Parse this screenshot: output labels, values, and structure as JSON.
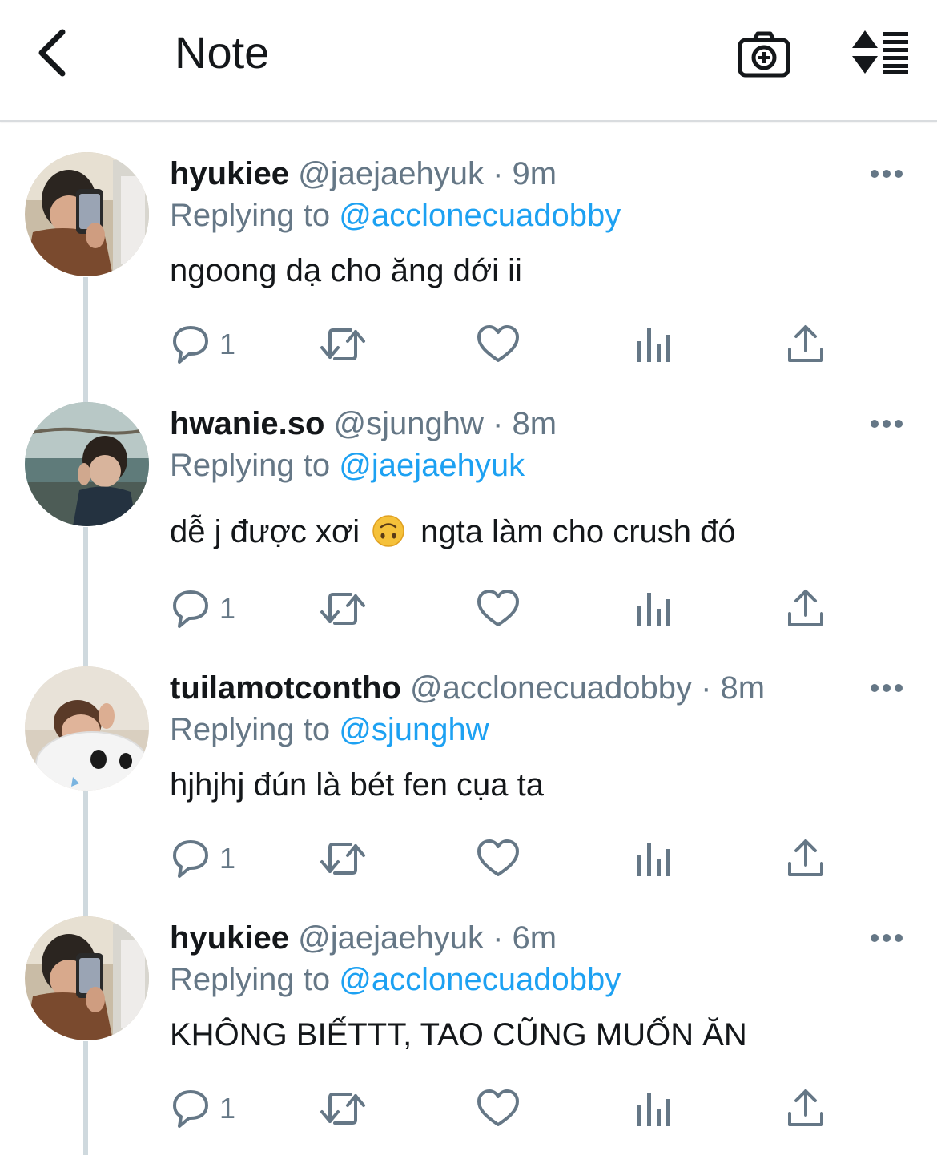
{
  "header": {
    "title": "Note",
    "back_icon": "chevron-left-icon",
    "camera_icon": "camera-plus-icon",
    "sort_icon": "sort-list-icon"
  },
  "colors": {
    "link": "#1da1f2",
    "muted": "#657786",
    "text": "#14171a",
    "thread_line": "#cfd9de"
  },
  "tweets": [
    {
      "display_name": "hyukiee",
      "handle": "@jaejaehyuk",
      "separator": "·",
      "time": "9m",
      "replying_prefix": "Replying to",
      "replying_handle": "@acclonecuadobby",
      "text": "ngoong dạ cho ăng dới ii",
      "reply_count": "1"
    },
    {
      "display_name": "hwanie.so",
      "handle": "@sjunghw",
      "separator": "·",
      "time": "8m",
      "replying_prefix": "Replying to",
      "replying_handle": "@jaejaehyuk",
      "text_before_emoji": "dễ j được xơi",
      "emoji": "upside-down-face-emoji",
      "text_after_emoji": "ngta làm cho crush đó",
      "reply_count": "1"
    },
    {
      "display_name": "tuilamotcontho",
      "handle": "@acclonecuadobby",
      "separator": "·",
      "time": "8m",
      "replying_prefix": "Replying to",
      "replying_handle": "@sjunghw",
      "text": "hjhjhj đún là bét fen cụa ta",
      "reply_count": "1"
    },
    {
      "display_name": "hyukiee",
      "handle": "@jaejaehyuk",
      "separator": "·",
      "time": "6m",
      "replying_prefix": "Replying to",
      "replying_handle": "@acclonecuadobby",
      "text": "KHÔNG BIẾTTT, TAO CŨNG MUỐN ĂN",
      "reply_count": "1"
    }
  ]
}
